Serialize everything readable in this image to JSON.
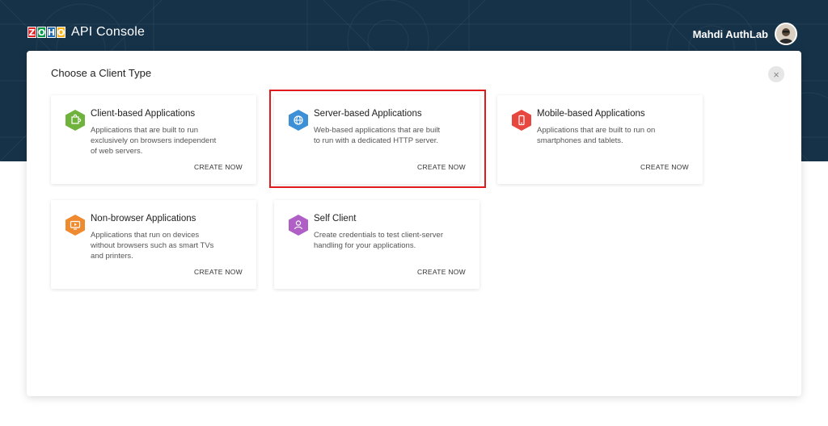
{
  "header": {
    "logo_letters": [
      "Z",
      "O",
      "H",
      "O"
    ],
    "logo_colors": [
      "#e42527",
      "#089949",
      "#226db4",
      "#f9b21d"
    ],
    "app_title": "API Console",
    "user_name": "Mahdi AuthLab"
  },
  "panel": {
    "title": "Choose a Client Type",
    "close_symbol": "×"
  },
  "cards": [
    {
      "title": "Client-based Applications",
      "description": "Applications that are built to run exclusively on browsers independent of web servers.",
      "cta": "CREATE NOW",
      "icon": "puzzle-icon",
      "color": "#6fb33d"
    },
    {
      "title": "Server-based Applications",
      "description": "Web-based applications that are built to run with a dedicated HTTP server.",
      "cta": "CREATE NOW",
      "icon": "globe-icon",
      "color": "#3d8fd6"
    },
    {
      "title": "Mobile-based Applications",
      "description": "Applications that are built to run on smartphones and tablets.",
      "cta": "CREATE NOW",
      "icon": "mobile-icon",
      "color": "#e8473f"
    },
    {
      "title": "Non-browser Applications",
      "description": "Applications that run on devices without browsers such as smart TVs and printers.",
      "cta": "CREATE NOW",
      "icon": "tv-icon",
      "color": "#f08a2e"
    },
    {
      "title": "Self Client",
      "description": "Create credentials to test client-server handling for your applications.",
      "cta": "CREATE NOW",
      "icon": "user-icon",
      "color": "#b05fc6"
    }
  ],
  "colors": {
    "header_bg": "#163248",
    "highlight": "#e11b1b"
  }
}
